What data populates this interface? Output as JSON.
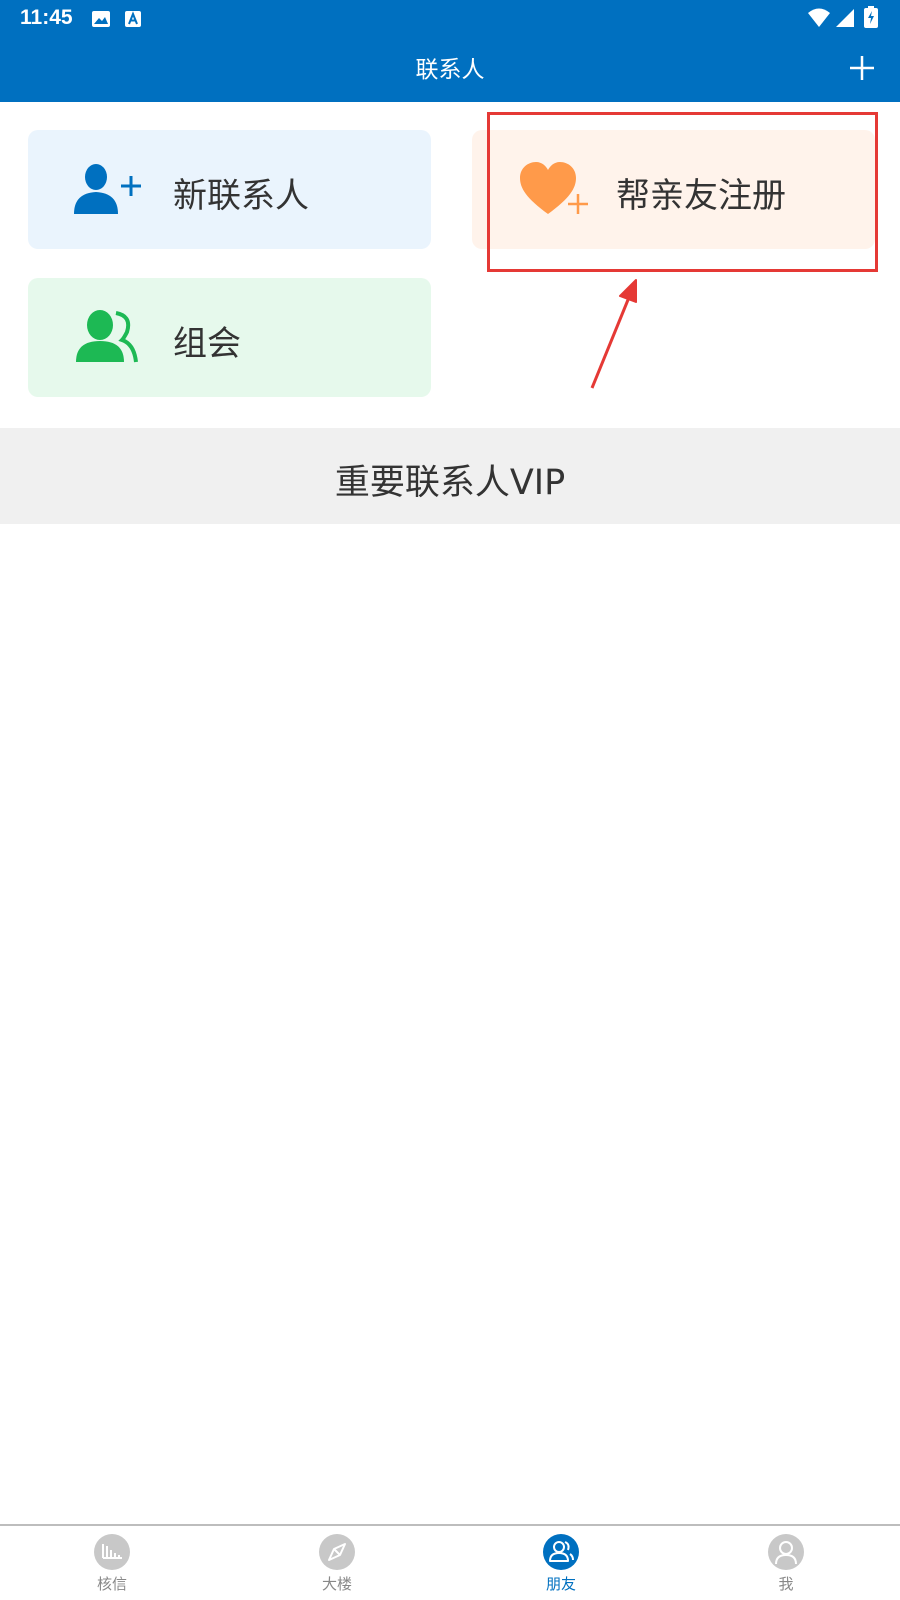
{
  "status_bar": {
    "time": "11:45"
  },
  "header": {
    "title": "联系人"
  },
  "cards": {
    "new_contact": "新联系人",
    "help_register": "帮亲友注册",
    "group": "组会"
  },
  "vip_section": {
    "label": "重要联系人VIP"
  },
  "bottom_nav": {
    "items": [
      {
        "label": "核信",
        "icon": "chart-icon"
      },
      {
        "label": "大楼",
        "icon": "compass-icon"
      },
      {
        "label": "朋友",
        "icon": "friends-icon"
      },
      {
        "label": "我",
        "icon": "person-icon"
      }
    ],
    "active": "朋友"
  },
  "colors": {
    "primary": "#0070C0",
    "new_card_bg": "#EAF4FD",
    "register_card_bg": "#FFF3EB",
    "group_card_bg": "#E6F9EC",
    "heart": "#FF9A4A",
    "group_icon": "#1DB954",
    "annotation": "#E53935"
  }
}
